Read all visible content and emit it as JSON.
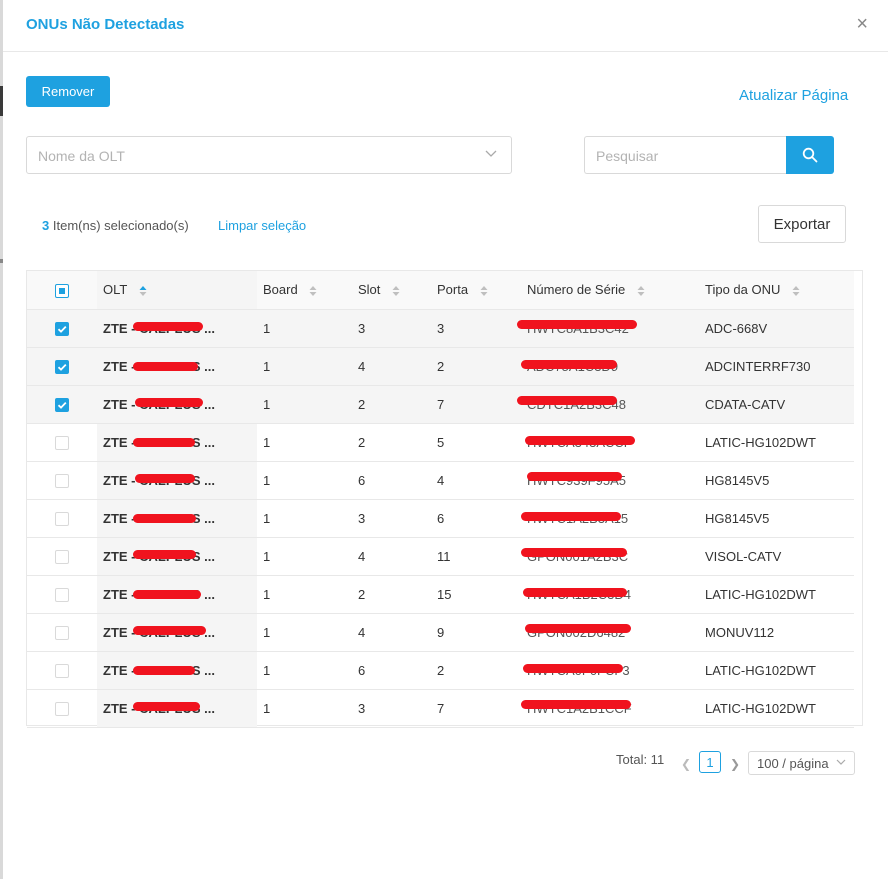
{
  "modal": {
    "title": "ONUs Não Detectadas",
    "close_symbol": "×"
  },
  "toolbar": {
    "remove_label": "Remover",
    "refresh_label": "Atualizar Página"
  },
  "filters": {
    "olt_placeholder": "Nome da OLT",
    "search_placeholder": "Pesquisar"
  },
  "selection": {
    "count": "3",
    "suffix": "Item(ns) selecionado(s)",
    "clear_label": "Limpar seleção"
  },
  "export_label": "Exportar",
  "table": {
    "columns": [
      "OLT",
      "Board",
      "Slot",
      "Porta",
      "Número de Série",
      "Tipo da ONU"
    ],
    "rows": [
      {
        "selected": true,
        "olt": "ZTE - CALPLUS ...",
        "board": "1",
        "slot": "3",
        "porta": "3",
        "serie": "HWTC8A1B3C42",
        "tipo": "ADC-668V"
      },
      {
        "selected": true,
        "olt": "ZTE - CALPLUS ...",
        "board": "1",
        "slot": "4",
        "porta": "2",
        "serie": "ADC75A1C3D9",
        "tipo": "ADCINTERRF730"
      },
      {
        "selected": true,
        "olt": "ZTE - CALPLUS ...",
        "board": "1",
        "slot": "2",
        "porta": "7",
        "serie": "CDTC1A2B3C48",
        "tipo": "CDATA-CATV"
      },
      {
        "selected": false,
        "olt": "ZTE - CALPLUS ...",
        "board": "1",
        "slot": "2",
        "porta": "5",
        "serie": "HWTCA343ACCF",
        "tipo": "LATIC-HG102DWT"
      },
      {
        "selected": false,
        "olt": "ZTE - CALPLUS ...",
        "board": "1",
        "slot": "6",
        "porta": "4",
        "serie": "HWTC939F95A5",
        "tipo": "HG8145V5"
      },
      {
        "selected": false,
        "olt": "ZTE - CALPLUS ...",
        "board": "1",
        "slot": "3",
        "porta": "6",
        "serie": "HWTC1A2B3A15",
        "tipo": "HG8145V5"
      },
      {
        "selected": false,
        "olt": "ZTE - CALPLUS ...",
        "board": "1",
        "slot": "4",
        "porta": "11",
        "serie": "GPON001A2B3C",
        "tipo": "VISOL-CATV"
      },
      {
        "selected": false,
        "olt": "ZTE - CALPLUS ...",
        "board": "1",
        "slot": "2",
        "porta": "15",
        "serie": "HWTCA1B2C3D4",
        "tipo": "LATIC-HG102DWT"
      },
      {
        "selected": false,
        "olt": "ZTE - CALPLUS ...",
        "board": "1",
        "slot": "4",
        "porta": "9",
        "serie": "GPON002D6482",
        "tipo": "MONUV112"
      },
      {
        "selected": false,
        "olt": "ZTE - CALPLUS ...",
        "board": "1",
        "slot": "6",
        "porta": "2",
        "serie": "HWTCA0F0FCF3",
        "tipo": "LATIC-HG102DWT"
      },
      {
        "selected": false,
        "olt": "ZTE - CALPLUS ...",
        "board": "1",
        "slot": "3",
        "porta": "7",
        "serie": "HWTC1A2B1CCF",
        "tipo": "LATIC-HG102DWT"
      }
    ]
  },
  "pagination": {
    "total_label": "Total: 11",
    "current_page": "1",
    "page_size_label": "100 / página"
  },
  "colors": {
    "accent": "#1ea1e0",
    "redaction": "#f0131e"
  }
}
